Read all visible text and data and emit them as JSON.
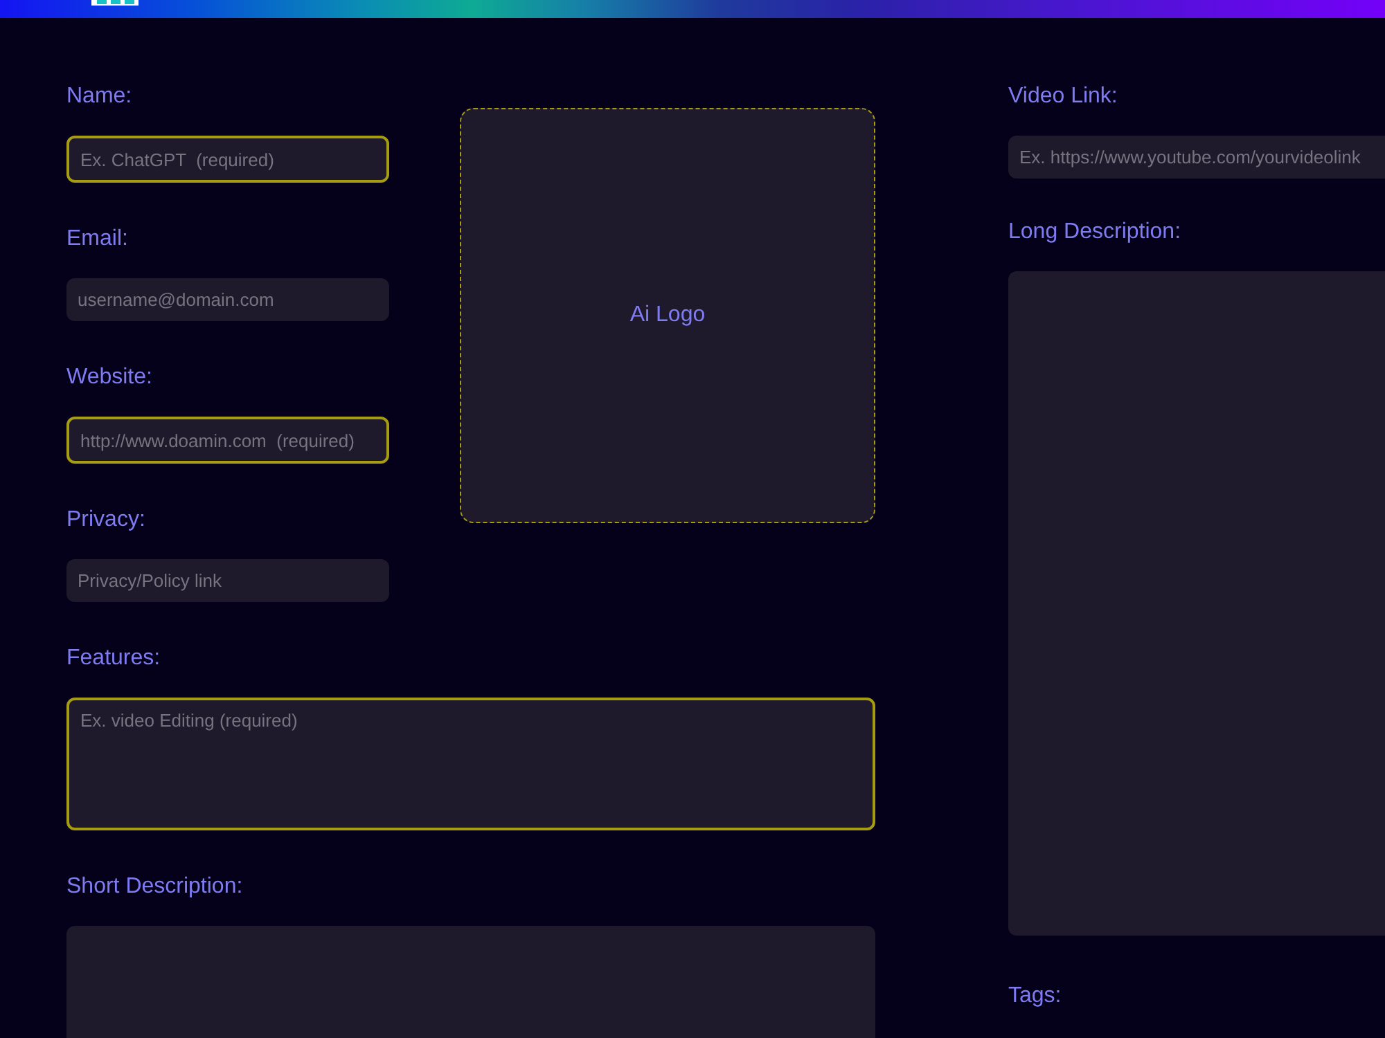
{
  "left_fields": [
    {
      "label": "Name:",
      "kind": "input",
      "placeholder": "Ex. ChatGPT  (required)",
      "required": true
    },
    {
      "label": "Email:",
      "kind": "input",
      "placeholder": "username@domain.com",
      "required": false
    },
    {
      "label": "Website:",
      "kind": "input",
      "placeholder": "http://www.doamin.com  (required)",
      "required": true
    },
    {
      "label": "Privacy:",
      "kind": "input",
      "placeholder": "Privacy/Policy link",
      "required": false
    }
  ],
  "logo_upload": {
    "label": "Ai Logo"
  },
  "wide_fields": [
    {
      "label": "Features:",
      "kind": "textarea",
      "placeholder": "Ex. video Editing (required)",
      "required": true
    },
    {
      "label": "Short Description:",
      "kind": "textarea",
      "required": false
    }
  ],
  "right_fields": [
    {
      "label": "Video Link:",
      "kind": "input",
      "placeholder": "Ex. https://www.youtube.com/yourvideolink",
      "required": false
    },
    {
      "label": "Long Description:",
      "kind": "textarea",
      "required": false
    },
    {
      "label": "Tags:"
    }
  ]
}
